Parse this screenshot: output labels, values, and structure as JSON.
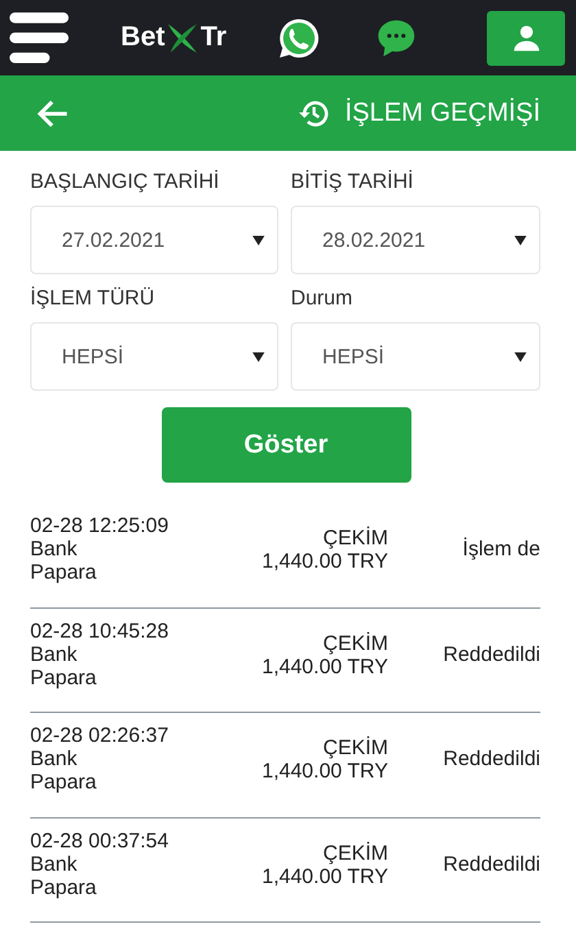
{
  "header": {
    "logo_left": "Bet",
    "logo_right": "Tr"
  },
  "title_bar": {
    "title": "İŞLEM GEÇMİŞİ"
  },
  "filters": [
    {
      "label": "BAŞLANGIÇ TARİHİ",
      "value": "27.02.2021"
    },
    {
      "label": "BİTİŞ TARİHİ",
      "value": "28.02.2021"
    },
    {
      "label": "İŞLEM TÜRÜ",
      "value": "HEPSİ"
    },
    {
      "label": "Durum",
      "value": "HEPSİ"
    }
  ],
  "show_button": "Göster",
  "transactions": [
    {
      "time": "02-28 12:25:09",
      "bank": "Bank",
      "method": "Papara",
      "type": "ÇEKİM",
      "amount": "1,440.00 TRY",
      "status": "İşlem de"
    },
    {
      "time": "02-28 10:45:28",
      "bank": "Bank",
      "method": "Papara",
      "type": "ÇEKİM",
      "amount": "1,440.00 TRY",
      "status": "Reddedildi"
    },
    {
      "time": "02-28 02:26:37",
      "bank": "Bank",
      "method": "Papara",
      "type": "ÇEKİM",
      "amount": "1,440.00 TRY",
      "status": "Reddedildi"
    },
    {
      "time": "02-28 00:37:54",
      "bank": "Bank",
      "method": "Papara",
      "type": "ÇEKİM",
      "amount": "1,440.00 TRY",
      "status": "Reddedildi"
    }
  ]
}
